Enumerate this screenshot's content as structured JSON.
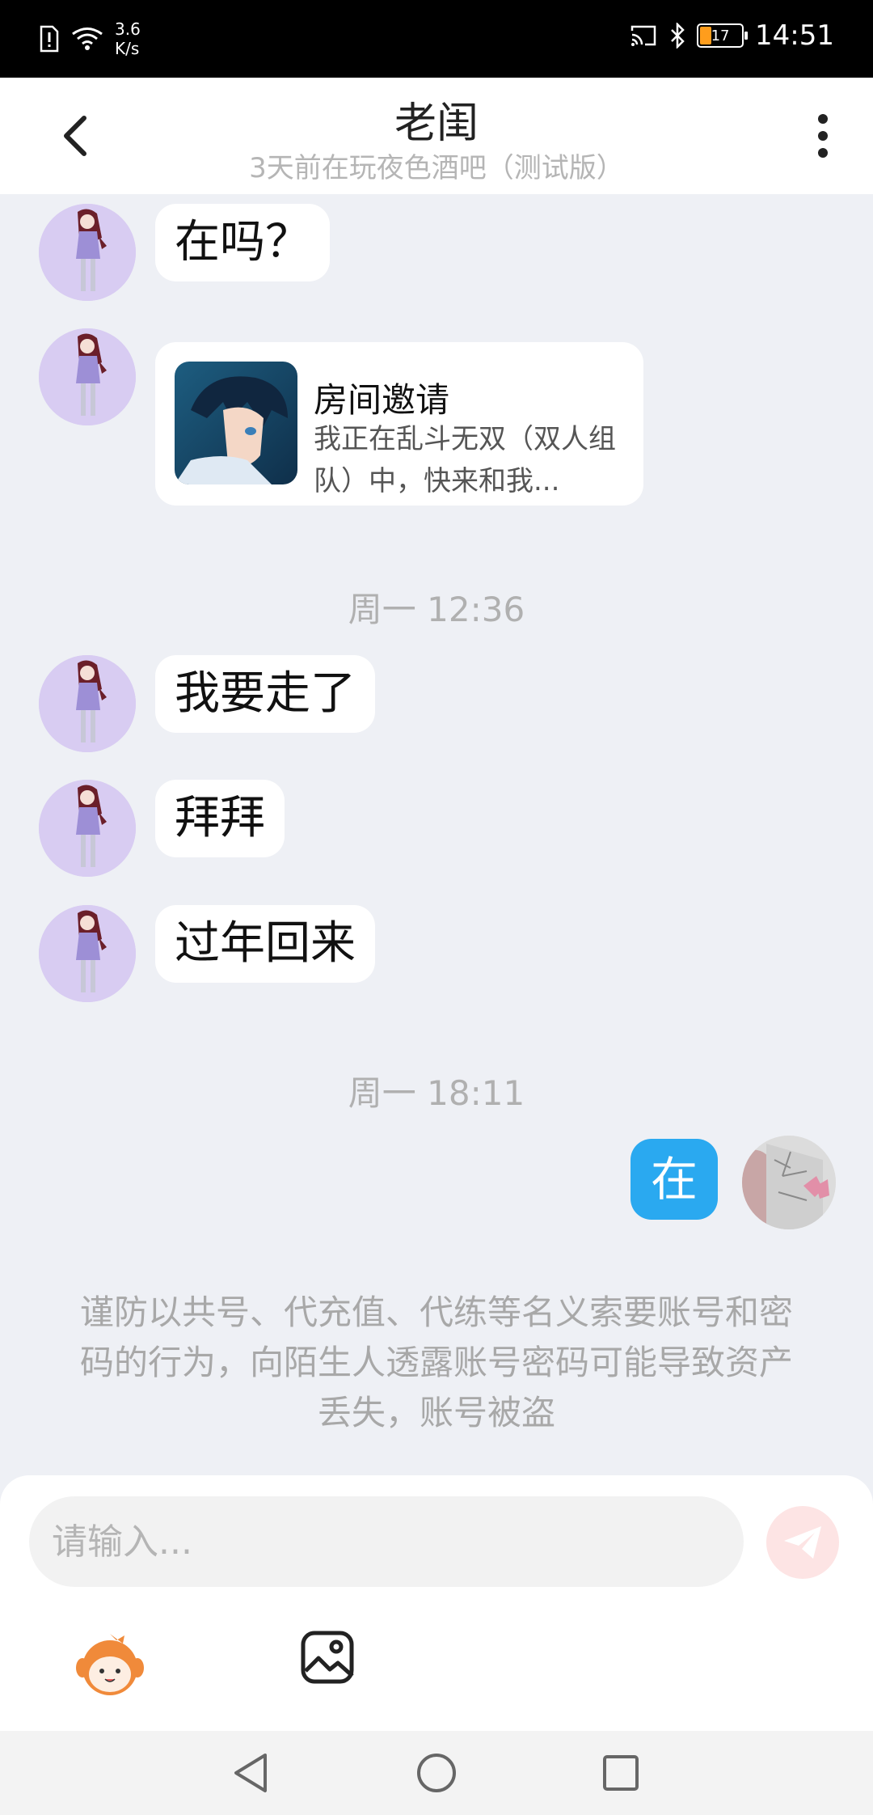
{
  "status_bar": {
    "net_speed_value": "3.6",
    "net_speed_unit": "K/s",
    "battery": "17",
    "time": "14:51"
  },
  "header": {
    "title": "老闺",
    "subtitle": "3天前在玩夜色酒吧（测试版）"
  },
  "messages": [
    {
      "text": "在吗？"
    },
    {
      "invite_title": "房间邀请",
      "invite_desc": "我正在乱斗无双（双人组队）中，快来和我..."
    },
    {
      "timestamp": "周一 12:36"
    },
    {
      "text": "我要走了"
    },
    {
      "text": "拜拜"
    },
    {
      "text": "过年回来"
    },
    {
      "timestamp": "周一 18:11"
    },
    {
      "text": "在"
    }
  ],
  "warning": "谨防以共号、代充值、代练等名义索要账号和密码的行为，向陌生人透露账号密码可能导致资产丢失，账号被盗",
  "input": {
    "placeholder": "请输入..."
  },
  "colors": {
    "accent_blue": "#2aa9f0",
    "send_disabled": "#fde4e4",
    "avatar_bg": "#d6c9f0"
  },
  "icons": [
    "back-arrow-icon",
    "more-icon",
    "send-icon",
    "emoji-sticker-icon",
    "image-icon",
    "nav-back-icon",
    "nav-home-icon",
    "nav-recent-icon"
  ]
}
